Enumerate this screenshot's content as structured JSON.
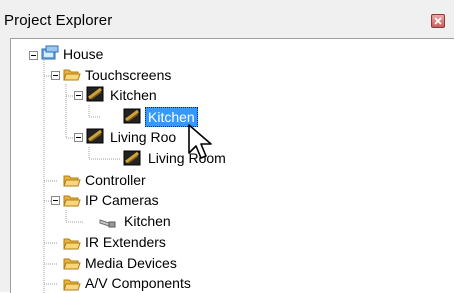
{
  "panel": {
    "title": "Project Explorer"
  },
  "tree": {
    "house": "House",
    "touchscreens": "Touchscreens",
    "kitchen_device": "Kitchen",
    "kitchen_room": "Kitchen",
    "living_device": "Living Roo",
    "living_room": "Living Room",
    "controller": "Controller",
    "ip_cameras": "IP Cameras",
    "camera_kitchen": "Kitchen",
    "ir_extenders": "IR Extenders",
    "media_devices": "Media Devices",
    "av_components": "A/V Components"
  },
  "colors": {
    "selection": "#3399ff",
    "folder": "#f2c14e",
    "close": "#c9605a"
  },
  "icons": {
    "house": "house-icon",
    "folder": "folder-icon",
    "touchscreen": "touchscreen-device-icon",
    "camera": "ip-camera-icon",
    "close": "close-icon",
    "cursor": "mouse-cursor-icon"
  }
}
